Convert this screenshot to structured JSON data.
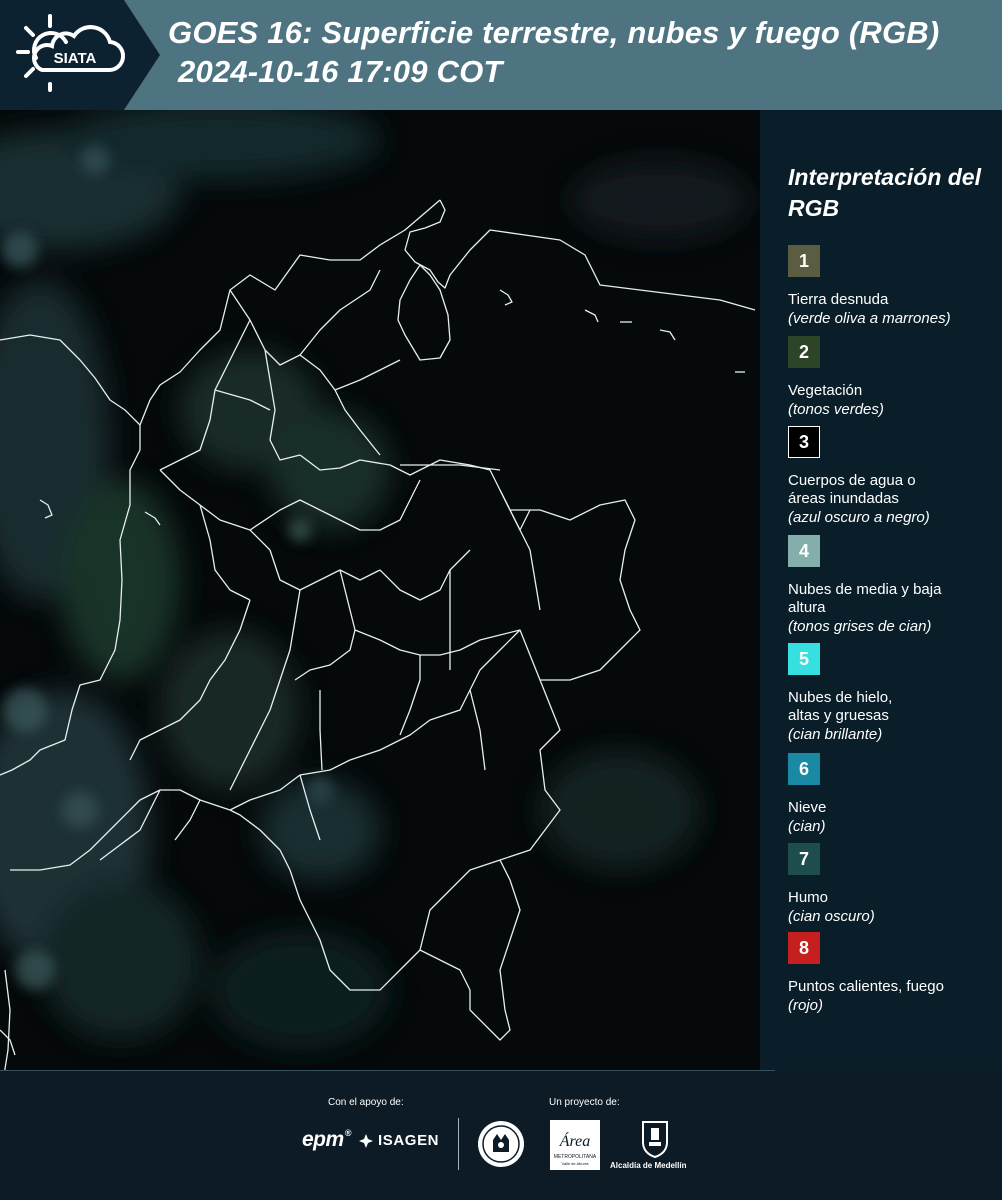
{
  "header": {
    "logo_text": "SIATA",
    "title_line1": "GOES 16: Superficie terrestre, nubes y fuego (RGB)",
    "title_line2": "2024-10-16 17:09 COT"
  },
  "legend": {
    "title": "Interpretación del RGB",
    "items": [
      {
        "number": "1",
        "label": "Tierra desnuda",
        "sublabel": "(verde oliva a marrones)",
        "color": "#5b5d42"
      },
      {
        "number": "2",
        "label": "Vegetación",
        "sublabel": "(tonos verdes)",
        "color": "#2d4526"
      },
      {
        "number": "3",
        "label": "Cuerpos de agua o áreas inundadas",
        "sublabel": "(azul oscuro a negro)",
        "color": "#000000"
      },
      {
        "number": "4",
        "label": "Nubes de media y baja altura",
        "sublabel": "(tonos grises de cian)",
        "color": "#83aeab"
      },
      {
        "number": "5",
        "label": "Nubes de hielo, altas y gruesas",
        "sublabel": "(cian brillante)",
        "color": "#37e0e0"
      },
      {
        "number": "6",
        "label": "Nieve",
        "sublabel": "(cian)",
        "color": "#1a8aa4"
      },
      {
        "number": "7",
        "label": "Humo",
        "sublabel": "(cian oscuro)",
        "color": "#1e4d4e"
      },
      {
        "number": "8",
        "label": "Puntos calientes, fuego",
        "sublabel": "(rojo)",
        "color": "#c61f1f"
      }
    ]
  },
  "footer": {
    "support_label": "Con el apoyo de:",
    "project_label": "Un proyecto de:",
    "epm_logo": "epm",
    "isagen_logo": "ISAGEN",
    "area_logo": "Área",
    "area_logo_sub": "METROPOLITANA",
    "area_logo_sub2": "Valle de Aburrá",
    "alcaldia_logo": "Alcaldía de Medellín"
  }
}
